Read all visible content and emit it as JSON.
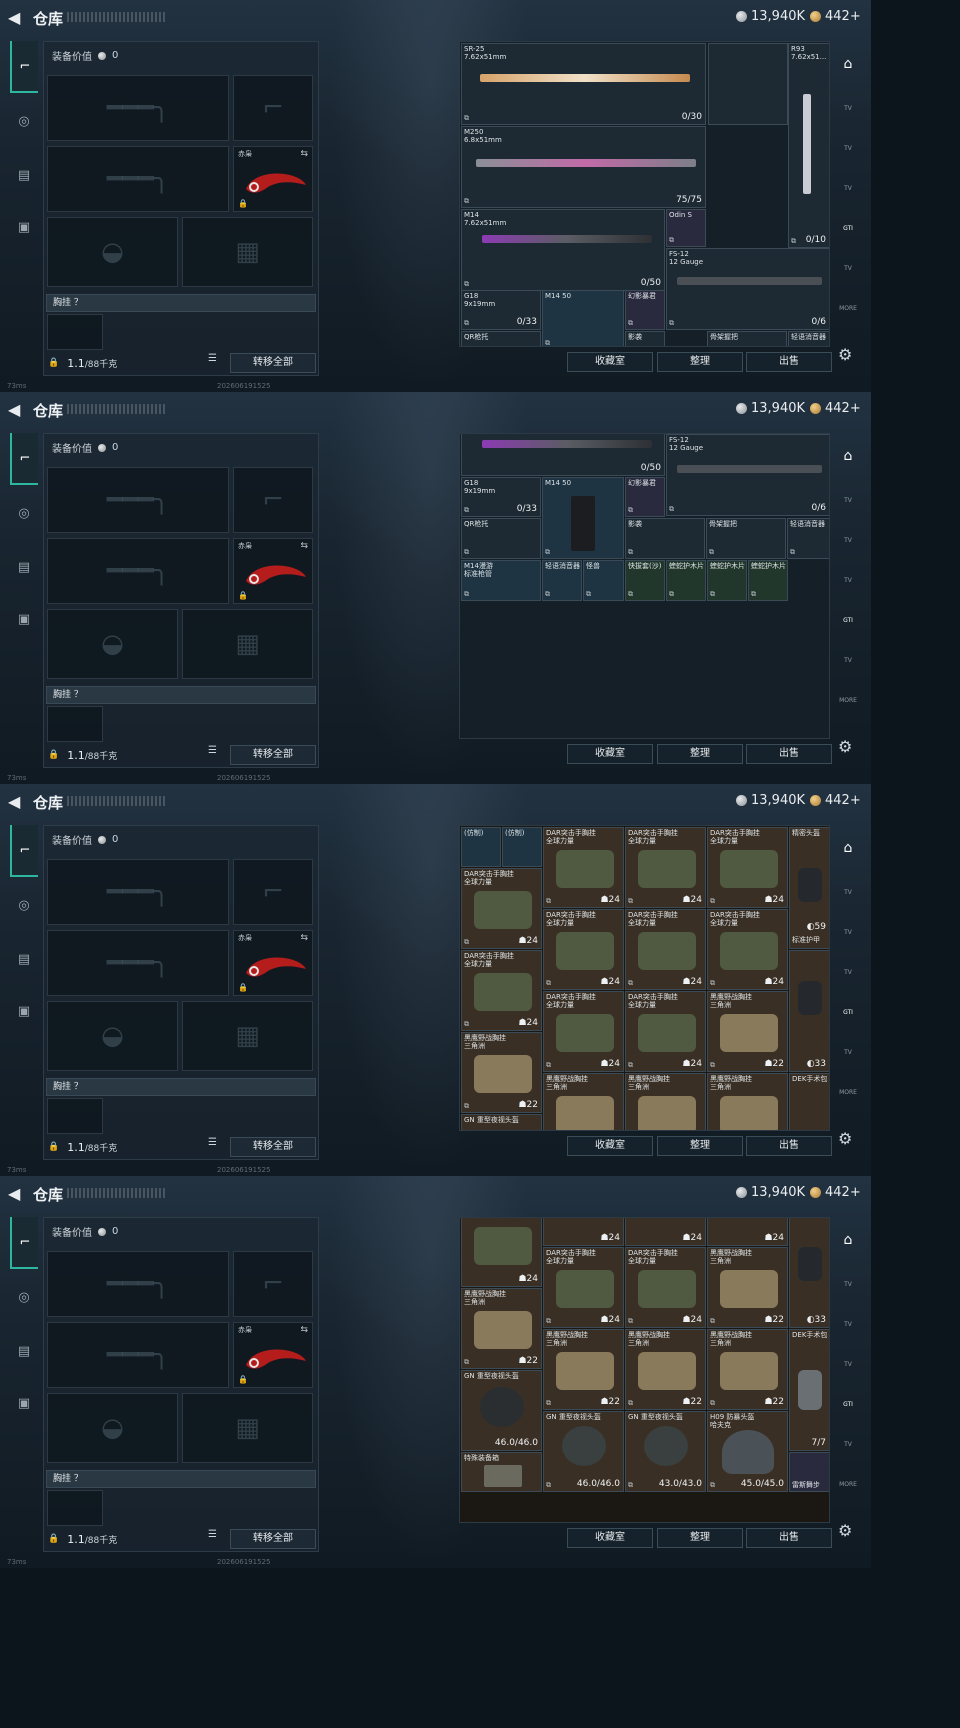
{
  "header": {
    "title": "仓库",
    "silver": "13,940K",
    "gold": "442+"
  },
  "loadout": {
    "equip_value_label": "装备价值",
    "equip_value": "0",
    "knife_name": "赤枭",
    "chest_label": "胸挂 ？",
    "weight_value": "1.1",
    "weight_max": "/88千克",
    "transfer_all": "转移全部"
  },
  "actions": {
    "favorites": "收藏室",
    "sort": "整理",
    "sell": "出售"
  },
  "footer": {
    "ping": "73ms",
    "timestamp": "202606191525"
  },
  "right_tabs": [
    "TV",
    "TV",
    "TV",
    "GTI",
    "TV",
    "MORE",
    "MORE",
    "MORE"
  ],
  "stash1": [
    {
      "name": "SR-25",
      "sub": "7.62x51mm",
      "count": "0/30"
    },
    {
      "name": "R93",
      "sub": "7.62x51...",
      "count": "0/10"
    },
    {
      "name": "M250",
      "sub": "6.8x51mm",
      "count": "75/75"
    },
    {
      "name": "M14",
      "sub": "7.62x51mm",
      "count": "0/50"
    },
    {
      "name": "Odin S",
      "sub": "",
      "count": ""
    },
    {
      "name": "FS-12",
      "sub": "12 Gauge",
      "count": "0/6"
    },
    {
      "name": "G18",
      "sub": "9x19mm",
      "count": "0/33"
    },
    {
      "name": "M14 50",
      "sub": "",
      "count": ""
    },
    {
      "name": "幻影暴君",
      "sub": "",
      "count": ""
    },
    {
      "name": "QR枪托",
      "sub": "",
      "count": ""
    },
    {
      "name": "影袭",
      "sub": "",
      "count": ""
    },
    {
      "name": "骨架握把",
      "sub": "",
      "count": ""
    },
    {
      "name": "轻语消音器",
      "sub": "",
      "count": ""
    }
  ],
  "stash2": [
    {
      "name": "M14漫游",
      "sub": "标准枪管"
    },
    {
      "name": "轻语消音器",
      "sub": ""
    },
    {
      "name": "怪兽",
      "sub": ""
    },
    {
      "name": "快拔套(沙)",
      "sub": ""
    },
    {
      "name": "蝰蛇护木片",
      "sub": ""
    },
    {
      "name": "蝰蛇护木片",
      "sub": ""
    },
    {
      "name": "蝰蛇护木片",
      "sub": ""
    }
  ],
  "stash3": [
    {
      "name": "(仿制)",
      "count": ""
    },
    {
      "name": "(仿制)",
      "count": ""
    },
    {
      "name": "DAR突击手胸挂",
      "sub": "全球力量",
      "count": "24"
    },
    {
      "name": "DAR突击手胸挂",
      "sub": "全球力量",
      "count": "24"
    },
    {
      "name": "DAR突击手胸挂",
      "sub": "全球力量",
      "count": "24"
    },
    {
      "name": "精密头盔",
      "count": "59",
      "sub": "标准护甲"
    },
    {
      "name": "黑鹰野战胸挂",
      "sub": "三角洲",
      "count": "22"
    },
    {
      "name": "DEK手术包",
      "count": "33"
    },
    {
      "name": "GN 重型夜视头盔",
      "count": ""
    }
  ],
  "stash4": [
    {
      "name": "GN 重型夜视头盔",
      "count": "46.0/46.0"
    },
    {
      "name": "GN 重型夜视头盔",
      "count": "46.0/46.0"
    },
    {
      "name": "GN 重型夜视头盔",
      "count": "43.0/43.0"
    },
    {
      "name": "H09 防暴头盔",
      "sub": "哈夫克",
      "count": "45.0/45.0"
    },
    {
      "name": "特殊装备箱",
      "count": ""
    },
    {
      "name": "雷斯舞步",
      "count": "7/7"
    }
  ]
}
